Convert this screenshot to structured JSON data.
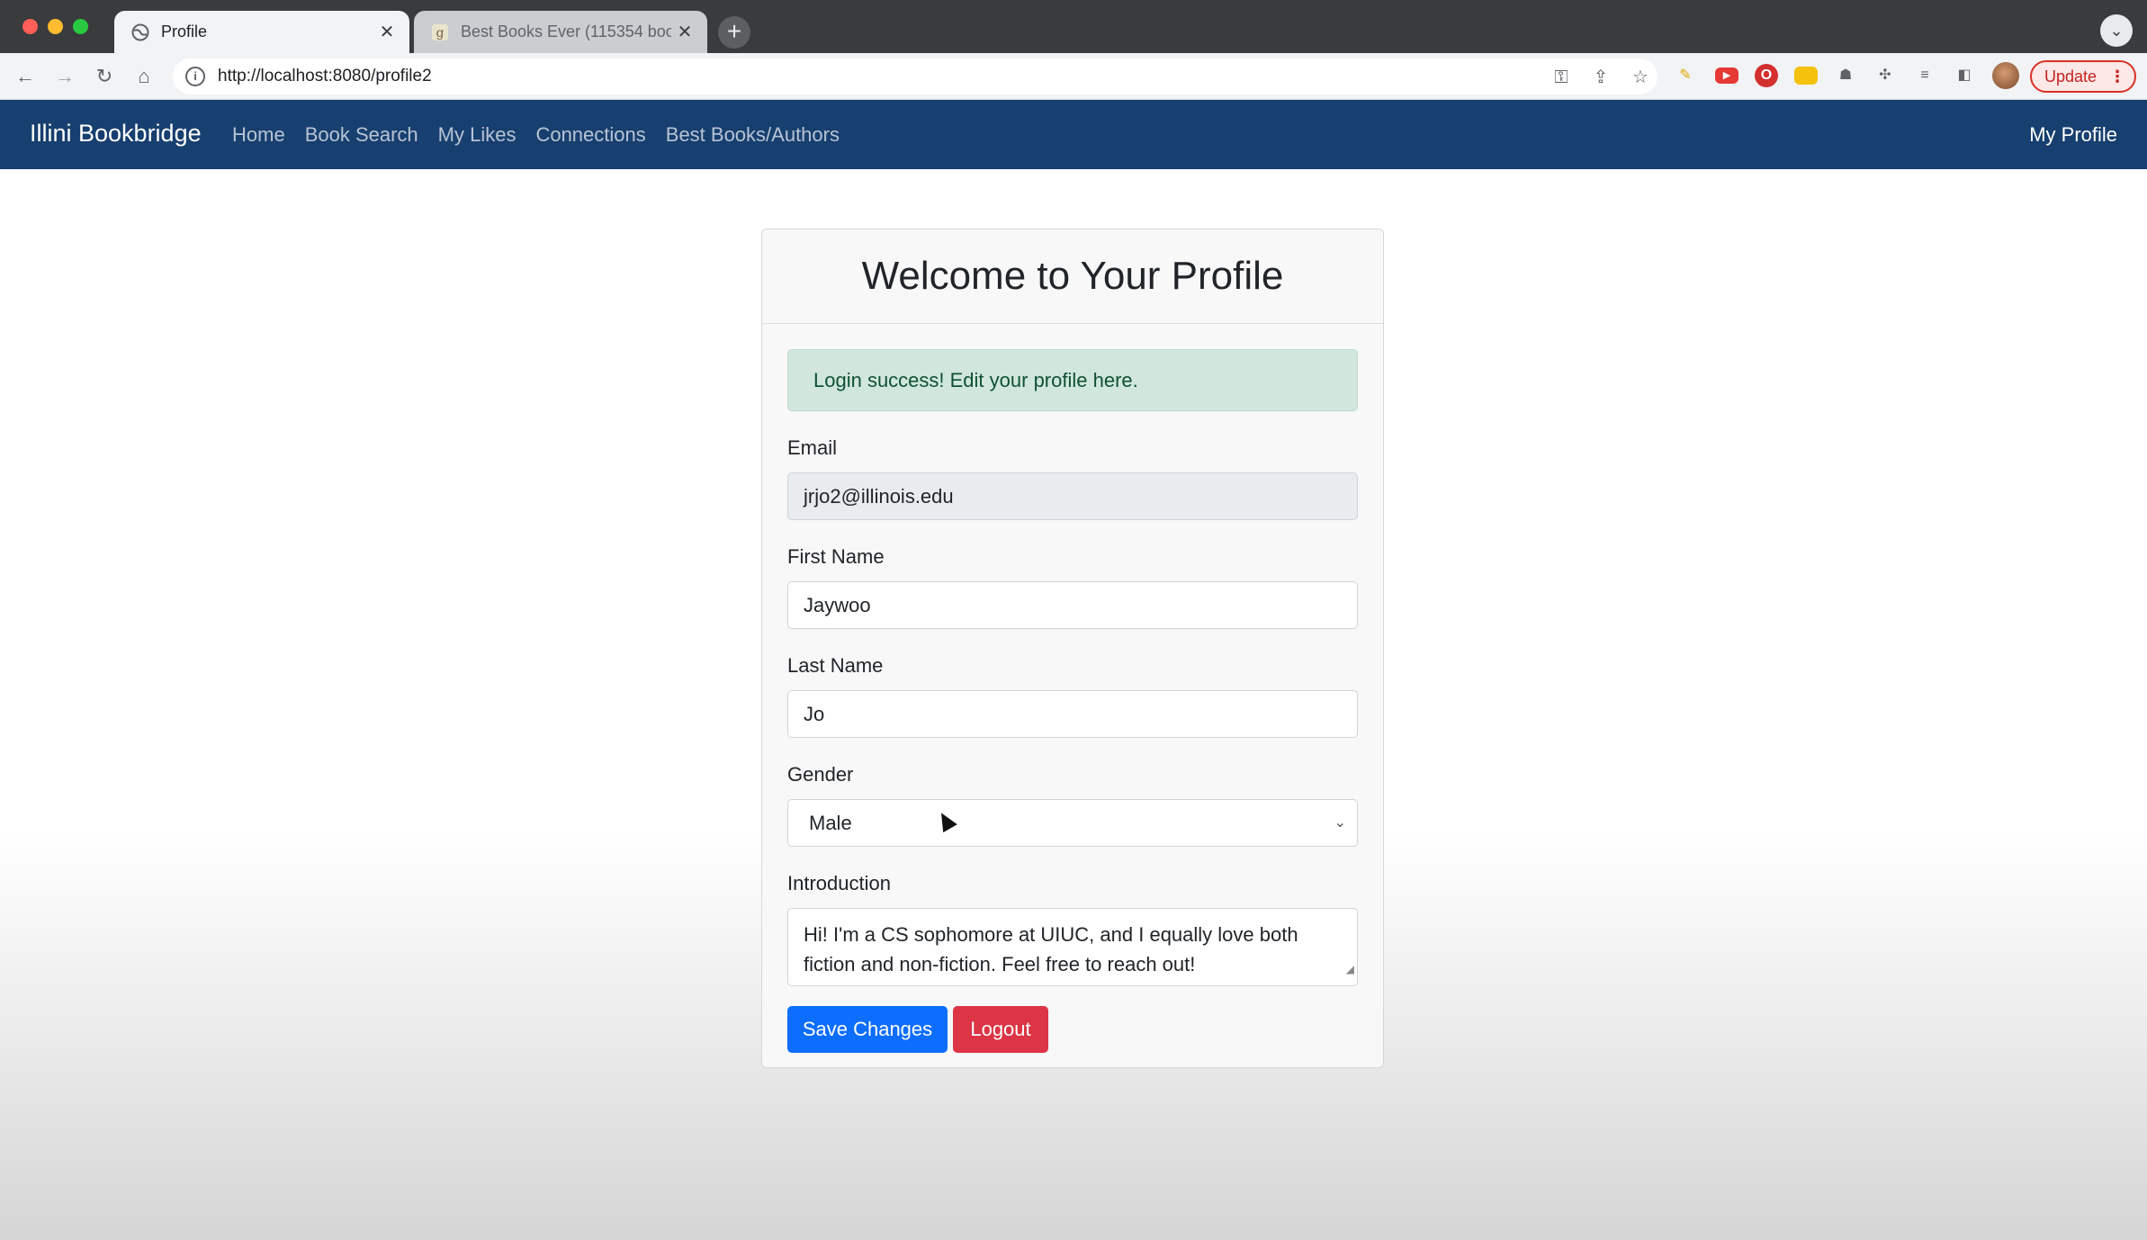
{
  "browser": {
    "tabs": [
      {
        "title": "Profile",
        "active": true
      },
      {
        "title": "Best Books Ever (115354 book",
        "active": false
      }
    ],
    "url": "http://localhost:8080/profile2",
    "update_label": "Update"
  },
  "navbar": {
    "brand": "Illini Bookbridge",
    "links": [
      "Home",
      "Book Search",
      "My Likes",
      "Connections",
      "Best Books/Authors"
    ],
    "profile_link": "My Profile",
    "bg_color": "#173f6f"
  },
  "profile": {
    "heading": "Welcome to Your Profile",
    "alert": "Login success! Edit your profile here.",
    "email_label": "Email",
    "email_value": "jrjo2@illinois.edu",
    "first_name_label": "First Name",
    "first_name_value": "Jaywoo",
    "last_name_label": "Last Name",
    "last_name_value": "Jo",
    "gender_label": "Gender",
    "gender_value": "Male",
    "intro_label": "Introduction",
    "intro_line1": "Hi! I'm a CS sophomore at UIUC, and I equally love both",
    "intro_line2": "fiction and non-fiction. Feel free to reach out!",
    "save_button": "Save Changes",
    "logout_button": "Logout"
  }
}
